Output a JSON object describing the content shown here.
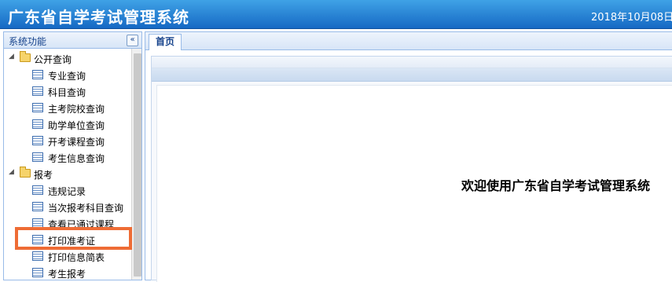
{
  "header": {
    "title": "广东省自学考试管理系统",
    "date": "2018年10月08日"
  },
  "sidebar": {
    "title": "系统功能",
    "collapse_glyph": "«",
    "groups": [
      {
        "label": "公开查询",
        "items": [
          {
            "label": "专业查询"
          },
          {
            "label": "科目查询"
          },
          {
            "label": "主考院校查询"
          },
          {
            "label": "助学单位查询"
          },
          {
            "label": "开考课程查询"
          },
          {
            "label": "考生信息查询"
          }
        ]
      },
      {
        "label": "报考",
        "items": [
          {
            "label": "违规记录"
          },
          {
            "label": "当次报考科目查询"
          },
          {
            "label": "查看已通过课程"
          },
          {
            "label": "打印准考证"
          },
          {
            "label": "打印信息简表"
          },
          {
            "label": "考生报考"
          }
        ]
      }
    ]
  },
  "tabs": [
    {
      "label": "首页"
    }
  ],
  "main": {
    "welcome": "欢迎使用广东省自学考试管理系统"
  },
  "colors": {
    "header": "#1e7ad0",
    "highlight": "#ee6c35"
  }
}
